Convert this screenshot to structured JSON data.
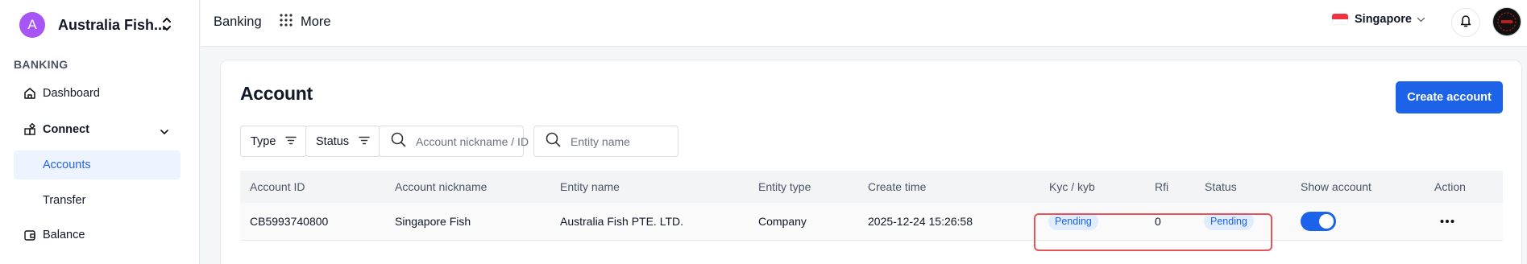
{
  "sidebar": {
    "org_initial": "A",
    "org_name": "Australia Fish...",
    "section_label": "BANKING",
    "items": [
      {
        "label": "Dashboard",
        "icon": "home-icon"
      },
      {
        "label": "Connect",
        "icon": "connect-icon"
      },
      {
        "label": "Accounts"
      },
      {
        "label": "Transfer"
      },
      {
        "label": "Balance",
        "icon": "wallet-icon"
      }
    ]
  },
  "topbar": {
    "banking_label": "Banking",
    "more_label": "More",
    "region_label": "Singapore",
    "region_flag": "singapore-flag-icon"
  },
  "page": {
    "title": "Account",
    "create_button": "Create account"
  },
  "filters": {
    "type_label": "Type",
    "status_label": "Status",
    "nickname_placeholder": "Account nickname / ID",
    "entity_placeholder": "Entity name"
  },
  "table": {
    "columns": [
      "Account ID",
      "Account nickname",
      "Entity name",
      "Entity type",
      "Create time",
      "Kyc / kyb",
      "Rfi",
      "Status",
      "Show account",
      "Action"
    ],
    "rows": [
      {
        "account_id": "CB5993740800",
        "nickname": "Singapore Fish",
        "entity_name": "Australia Fish PTE. LTD.",
        "entity_type": "Company",
        "create_time": "2025-12-24 15:26:58",
        "kyc": "Pending",
        "rfi": "0",
        "status": "Pending",
        "show_account": true
      }
    ]
  },
  "colors": {
    "accent": "#1d63ea",
    "org_avatar": "#a855f7",
    "highlight": "#e4555a"
  }
}
